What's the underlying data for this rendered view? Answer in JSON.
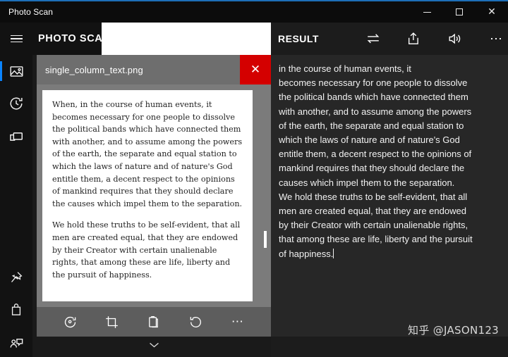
{
  "window": {
    "title": "Photo Scan",
    "accent_color": "#1d6fb8",
    "controls": {
      "minimize": "–",
      "maximize": "□",
      "close": "✕"
    }
  },
  "rail": {
    "items": [
      {
        "name": "menu",
        "icon": "hamburger-icon",
        "label": ""
      },
      {
        "name": "photo-scan",
        "icon": "image-icon",
        "label": "",
        "selected": true
      },
      {
        "name": "history",
        "icon": "history-icon",
        "label": ""
      },
      {
        "name": "screen-capture",
        "icon": "screen-capture-icon",
        "label": ""
      }
    ],
    "bottom_items": [
      {
        "name": "pin",
        "icon": "pin-icon",
        "label": ""
      },
      {
        "name": "store",
        "icon": "shopping-bag-icon",
        "label": ""
      },
      {
        "name": "feedback",
        "icon": "feedback-icon",
        "label": ""
      }
    ]
  },
  "left_pane": {
    "header_title": "PHOTO SCAN",
    "document": {
      "filename": "single_column_text.png",
      "close_label": "✕",
      "paragraphs": [
        "When, in the course of human events, it becomes necessary for one people to dissolve the political bands which have connected them with another, and to assume among the powers of the earth, the separate and equal station to which the laws of nature and of nature's God entitle them, a decent respect to the opinions of mankind requires that they should declare the causes which impel them to the separation.",
        "We hold these truths to be self-evident, that all men are created equal, that they are endowed by their Creator with certain unalienable rights, that among these are life, liberty and the pursuit of happiness."
      ]
    },
    "toolbar": [
      {
        "name": "rescan",
        "icon": "rescan-icon",
        "glyph": ""
      },
      {
        "name": "crop",
        "icon": "crop-icon",
        "glyph": ""
      },
      {
        "name": "copy",
        "icon": "clipboard-icon",
        "glyph": ""
      },
      {
        "name": "rotate",
        "icon": "rotate-icon",
        "glyph": ""
      },
      {
        "name": "more",
        "icon": "more-icon",
        "glyph": "⋯"
      }
    ],
    "expander_glyph": "⌄"
  },
  "right_pane": {
    "header_title": "RESULT",
    "actions": [
      {
        "name": "swap",
        "icon": "swap-icon"
      },
      {
        "name": "share",
        "icon": "share-icon"
      },
      {
        "name": "speak",
        "icon": "speaker-icon"
      },
      {
        "name": "more",
        "icon": "more-icon"
      }
    ],
    "result_text": "in the course of human events, it\nbecomes necessary for one people to dissolve\nthe political bands which have connected them\nwith another, and to assume among the powers\nof the earth, the separate and equal station to\nwhich the laws of nature and of nature's God\nentitle them, a decent respect to the opinions of\nmankind requires that they should declare the\ncauses which impel them to the separation.\nWe hold these truths to be self-evident, that all\nmen are created equal, that they are endowed\nby their Creator with certain unalienable rights,\nthat among these are life, liberty and the pursuit\nof happiness."
  },
  "watermark": {
    "text": "知乎 @JASON123"
  }
}
